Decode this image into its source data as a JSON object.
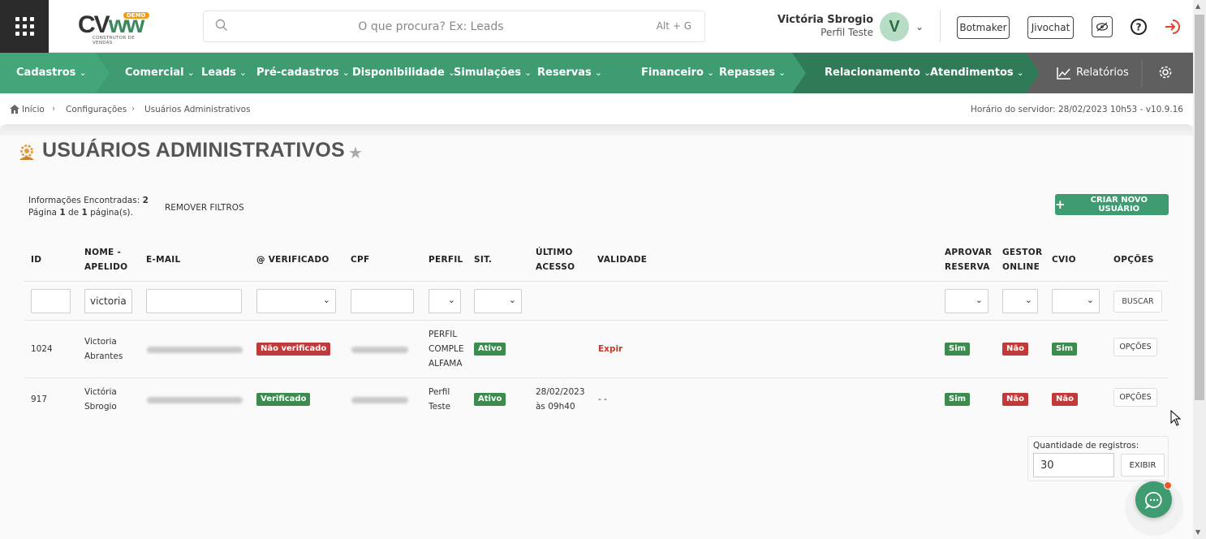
{
  "header": {
    "logo_text": "CV",
    "logo_badge": "DEMO",
    "logo_subtitle": "CONSTRUTOR DE VENDAS",
    "search_placeholder": "O que procura? Ex: Leads",
    "search_shortcut": "Alt + G",
    "user_name": "Victória Sbrogio",
    "user_profile": "Perfil Teste",
    "avatar_letter": "V",
    "botmaker_label": "Botmaker",
    "jivochat_label": "Jivochat"
  },
  "nav": {
    "items": [
      {
        "label": "Cadastros"
      },
      {
        "label": "Comercial"
      },
      {
        "label": "Leads"
      },
      {
        "label": "Pré-cadastros"
      },
      {
        "label": "Disponibilidade"
      },
      {
        "label": "Simulações"
      },
      {
        "label": "Reservas"
      },
      {
        "label": "Financeiro"
      },
      {
        "label": "Repasses"
      },
      {
        "label": "Relacionamento"
      },
      {
        "label": "Atendimentos"
      },
      {
        "label": "Relatórios"
      }
    ]
  },
  "breadcrumb": {
    "items": [
      "Início",
      "Configurações",
      "Usuários Administrativos"
    ],
    "server_time": "Horário do servidor: 28/02/2023 10h53 - v10.9.16"
  },
  "page": {
    "title": "USUÁRIOS ADMINISTRATIVOS",
    "info_found_label": "Informações Encontradas:",
    "info_found_count": "2",
    "info_page_prefix": "Página",
    "info_page_current": "1",
    "info_page_of": "de",
    "info_page_total": "1",
    "info_page_suffix": "página(s).",
    "remove_filters": "REMOVER FILTROS",
    "create_button": "CRIAR NOVO USUÁRIO"
  },
  "table": {
    "headers": {
      "id": "ID",
      "name": "NOME - APELIDO",
      "email": "E-MAIL",
      "verified": "@ VERIFICADO",
      "cpf": "CPF",
      "profile": "PERFIL",
      "sit": "SIT.",
      "last_access": "ÚLTIMO ACESSO",
      "validity": "VALIDADE",
      "approve": "APROVAR RESERVA",
      "online": "GESTOR ONLINE",
      "cvio": "CVIO",
      "options": "OPÇÕES"
    },
    "filters": {
      "name_value": "victoria",
      "search_button": "BUSCAR"
    },
    "rows": [
      {
        "id": "1024",
        "name_line1": "Victoria",
        "name_line2": "Abrantes",
        "verified": "Não verificado",
        "profile_line1": "PERFIL",
        "profile_line2": "COMPLE",
        "profile_line3": "ALFAMA",
        "sit": "Ativo",
        "last_access_line1": "",
        "last_access_line2": "",
        "validity": "Expir",
        "approve": "Sim",
        "online": "Não",
        "cvio": "Sim",
        "options": "OPÇÕES"
      },
      {
        "id": "917",
        "name_line1": "Victória",
        "name_line2": "Sbrogio",
        "verified": "Verificado",
        "profile_line1": "Perfil",
        "profile_line2": "Teste",
        "sit": "Ativo",
        "last_access_line1": "28/02/2023",
        "last_access_line2": "às 09h40",
        "validity": "- -",
        "approve": "Sim",
        "online": "Não",
        "cvio": "Não",
        "options": "OPÇÕES"
      }
    ]
  },
  "pagination": {
    "label": "Quantidade de registros:",
    "value": "30",
    "button": "EXIBIR"
  },
  "colors": {
    "brand_green": "#3f9c70",
    "nav_dark": "#2f7a57",
    "badge_green": "#3d8b4f",
    "badge_red": "#c0393b"
  }
}
